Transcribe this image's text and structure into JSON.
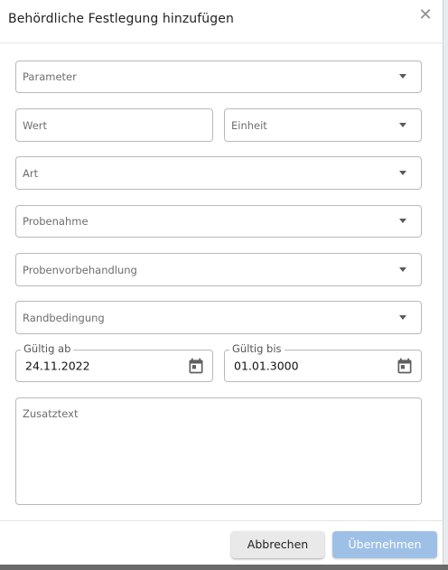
{
  "dialog": {
    "title": "Behördliche Festlegung hinzufügen",
    "close_icon": "close-icon"
  },
  "form": {
    "parameter_placeholder": "Parameter",
    "wert_placeholder": "Wert",
    "einheit_placeholder": "Einheit",
    "art_placeholder": "Art",
    "probenahme_placeholder": "Probenahme",
    "probenvorbehandlung_placeholder": "Probenvorbehandlung",
    "randbedingung_placeholder": "Randbedingung",
    "gueltig_ab_label": "Gültig ab",
    "gueltig_ab_value": "24.11.2022",
    "gueltig_bis_label": "Gültig bis",
    "gueltig_bis_value": "01.01.3000",
    "zusatztext_placeholder": "Zusatztext",
    "calendar_icon": "calendar-icon",
    "dropdown_icon": "chevron-down-icon"
  },
  "footer": {
    "cancel_label": "Abbrechen",
    "apply_label": "Übernehmen"
  },
  "colors": {
    "apply_button": "#9fc0e6",
    "cancel_button": "#e9e9e9",
    "field_border": "#b9b9b9"
  }
}
